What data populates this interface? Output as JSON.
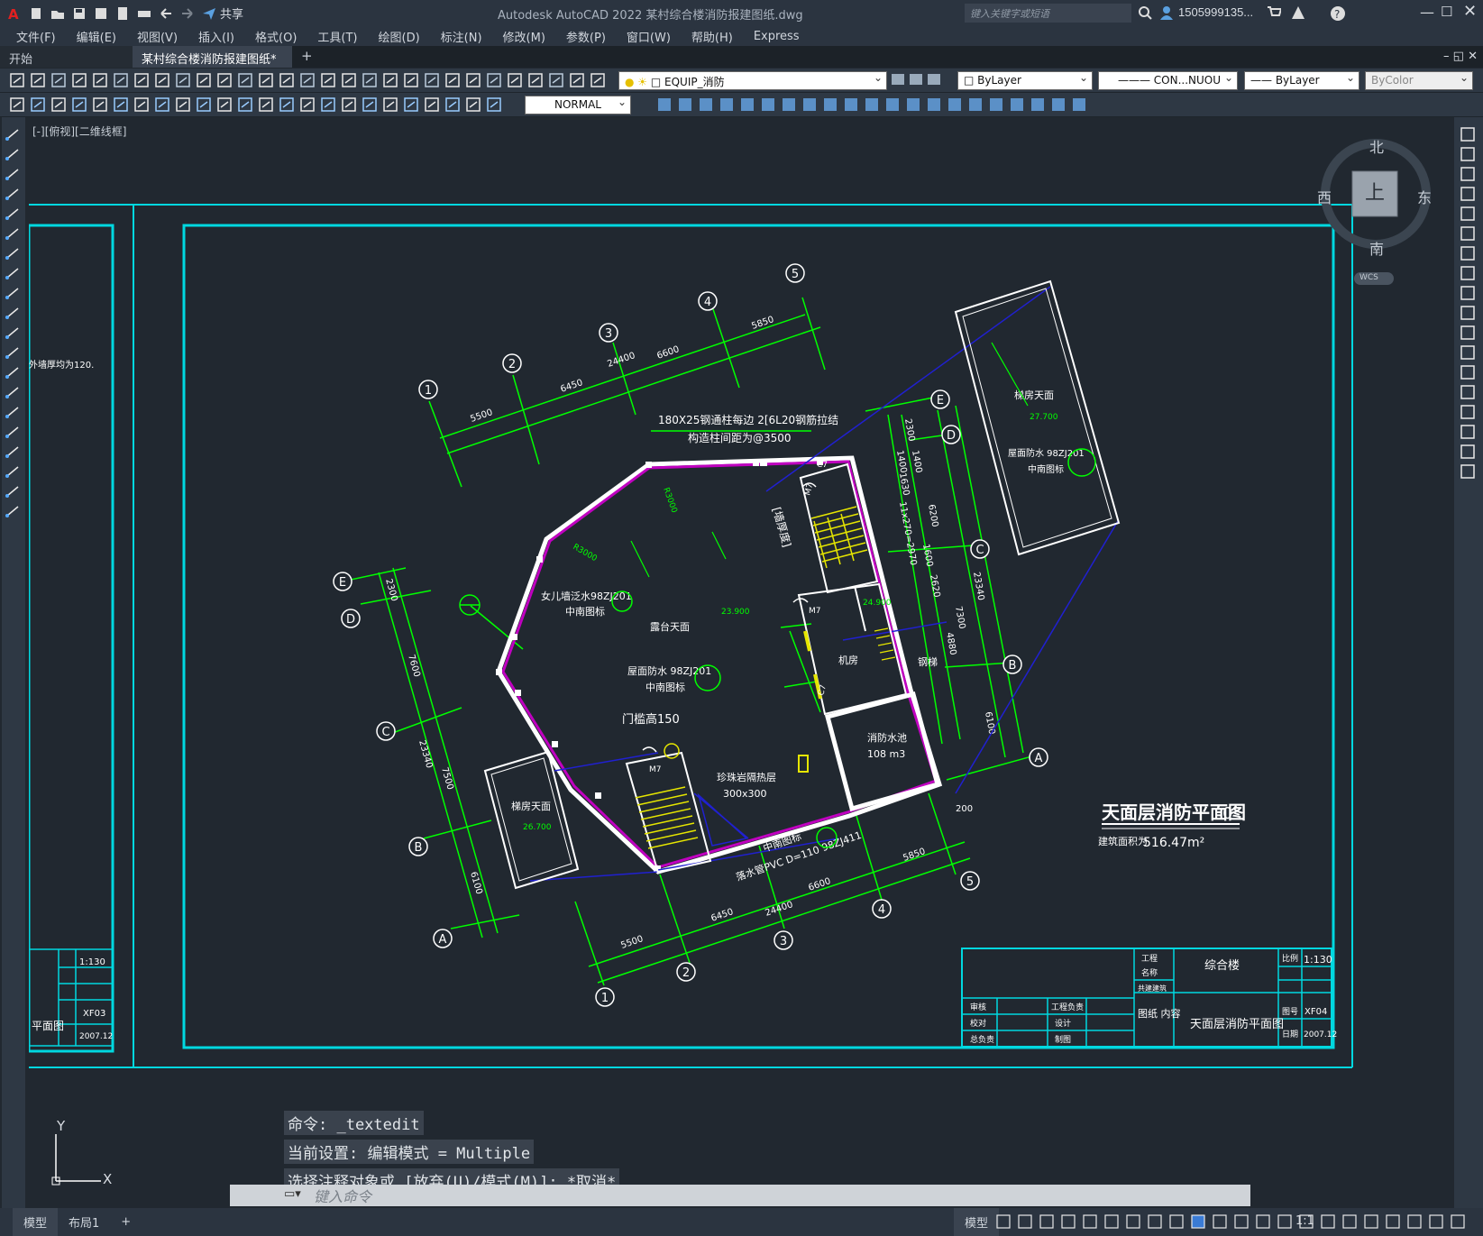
{
  "app": {
    "title": "Autodesk AutoCAD 2022    某村综合楼消防报建图纸.dwg",
    "share_label": "共享",
    "search_placeholder": "键入关键字或短语",
    "user": "1505999135..."
  },
  "menu": [
    "文件(F)",
    "编辑(E)",
    "视图(V)",
    "插入(I)",
    "格式(O)",
    "工具(T)",
    "绘图(D)",
    "标注(N)",
    "修改(M)",
    "参数(P)",
    "窗口(W)",
    "帮助(H)",
    "Express"
  ],
  "tabs": {
    "start": "开始",
    "active": "某村综合楼消防报建图纸*",
    "add": "+"
  },
  "toolbar": {
    "layer": "EQUIP_消防",
    "color": "ByLayer",
    "linetype": "CON...NUOU",
    "lineweight": "ByLayer",
    "plotstyle": "ByColor",
    "textstyle": "NORMAL"
  },
  "viewport": {
    "label": "[-][俯视][二维线框]",
    "viewcube": {
      "north": "北",
      "south": "南",
      "east": "东",
      "west": "西",
      "top": "上",
      "wcs": "WCS"
    }
  },
  "drawing": {
    "main_title": "天面层消防平面图",
    "scale_fragment": "0",
    "area_label": "建筑面积为",
    "area_value": "516.47m²",
    "dimensions": {
      "d1": "5500",
      "d2": "6450",
      "d3": "6600",
      "d4": "5850",
      "total": "24400",
      "left1": "2300",
      "left2": "7600",
      "left3": "23340",
      "left4": "7500",
      "left5": "6100",
      "right1": "2300",
      "right2": "1400",
      "right3": "1400",
      "right4": "1630",
      "right5": "11x270=2970",
      "right6": "6200",
      "right7": "1600",
      "right8": "2620",
      "right9": "7300",
      "right10": "4880",
      "right11": "23340",
      "right12": "6100"
    },
    "grid_num": [
      "1",
      "2",
      "3",
      "4",
      "5"
    ],
    "grid_letter": [
      "A",
      "B",
      "C",
      "D",
      "E"
    ],
    "labels": {
      "parapet_note": "180X25钢通柱每边 2[6L20钢筋拉结",
      "parapet_note2": "构造柱间距为@3500",
      "parapet_water": "女儿墙泛水98ZJ201",
      "zhongnan": "中南图标",
      "terrace": "露台天面",
      "level_main": "23.900",
      "roof_water": "屋面防水 98ZJ201",
      "door_sill": "门槛高150",
      "heater": "珍珠岩隔热层",
      "size": "300x300",
      "drain": "落水管PVC D=110 98ZJ411",
      "fire_pool": "消防水池",
      "pool_volume": "108 m3",
      "machine": "机房",
      "steel_ladder": "钢梯",
      "stair_roof": "梯房天面",
      "stair_level": "27.700",
      "stair_level2": "26.700",
      "roof_water2": "屋面防水 98ZJ201",
      "m7": "M7",
      "c7": "C7",
      "r3000": "R3000",
      "level_mech": "24.900",
      "left_note": "外墙厚均为120.",
      "wall_label": "[墙厚度]",
      "dim_200": "200"
    },
    "titleblock": {
      "project_k": "工程",
      "name_k": "名称",
      "project_name": "综合楼",
      "scale_k": "比例",
      "scale_v": "1:130",
      "sheet_k": "图号",
      "sheet_v": "XF04",
      "date_k": "日期",
      "date_v": "2007.12",
      "content_k": "图纸 内容",
      "content_v": "天面层消防平面图",
      "check": "审核",
      "proof": "校对",
      "chief": "总负责",
      "lead": "工程负责",
      "design": "设计",
      "draw": "制图",
      "stage": "共建建筑",
      "left_scale": "1:130",
      "left_sheet": "XF03",
      "left_date": "2007.12",
      "left_title": "平面图"
    }
  },
  "command": {
    "history": [
      "命令: _textedit",
      "当前设置: 编辑模式 = Multiple",
      "选择注释对象或 [放弃(U)/模式(M)]: *取消*"
    ],
    "placeholder": "键入命令"
  },
  "status": {
    "model_tab": "模型",
    "layout_tab": "布局1",
    "add": "+",
    "model_btn": "模型",
    "scale": "1:1"
  },
  "ucs": {
    "x": "X",
    "y": "Y"
  },
  "colors": {
    "bg": "#212830",
    "cyan": "#00e5ee",
    "green": "#00ff00",
    "magenta": "#c000c0",
    "yellow": "#e6e600",
    "blue": "#2020c0",
    "white": "#ffffff"
  }
}
